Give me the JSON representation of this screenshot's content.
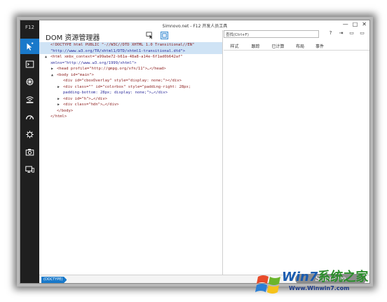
{
  "window": {
    "title": "Simnovo.net - F12 开发人员工具",
    "controls": [
      "—",
      "□",
      "✕"
    ]
  },
  "sidebar": {
    "label": "F12",
    "tools": [
      {
        "name": "dom-explorer",
        "icon": "cursor-icon",
        "active": true
      },
      {
        "name": "console",
        "icon": "console-icon",
        "active": false
      },
      {
        "name": "debugger",
        "icon": "bug-icon",
        "active": false
      },
      {
        "name": "network",
        "icon": "wifi-icon",
        "active": false
      },
      {
        "name": "performance",
        "icon": "gauge-icon",
        "active": false
      },
      {
        "name": "memory",
        "icon": "gear-icon",
        "active": false
      },
      {
        "name": "profiler",
        "icon": "camera-icon",
        "active": false
      },
      {
        "name": "emulation",
        "icon": "monitor-icon",
        "active": false
      }
    ]
  },
  "dom_panel": {
    "title": "DOM 资源管理器",
    "lines": [
      {
        "indent": 0,
        "tri": "",
        "tag": "<!DOCTYPE html PUBLIC \"-//W3C//DTD XHTML 1.0 Transitional//EN\"",
        "selected": true
      },
      {
        "indent": 0,
        "tri": "",
        "tag": "\"http://www.w3.org/TR/xhtml1/DTD/xhtml1-transitional.dtd\">",
        "selected": true
      },
      {
        "indent": 0,
        "tri": "▲",
        "tag": "<html xmbx_context=\"a99abe72-b61a-48a8-a14e-6f1ad0b642af\"",
        "selected": false
      },
      {
        "indent": 0,
        "tri": "",
        "tag": "xmlns=\"http://www.w3.org/1999/xhtml\">",
        "selected": false
      },
      {
        "indent": 1,
        "tri": "▶",
        "tag": "<head profile=\"http://gmpg.org/xfn/11\">…</head>",
        "selected": false
      },
      {
        "indent": 1,
        "tri": "▲",
        "tag": "<body id=\"main\">",
        "selected": false
      },
      {
        "indent": 2,
        "tri": "",
        "tag": "<div id=\"cboxOverlay\" style=\"display: none;\"></div>",
        "selected": false
      },
      {
        "indent": 2,
        "tri": "▶",
        "tag": "<div class=\"\" id=\"colorbox\" style=\"padding-right: 28px;",
        "selected": false
      },
      {
        "indent": 2,
        "tri": "",
        "tag": "padding-bottom: 28px; display: none;\">…</div>",
        "selected": false
      },
      {
        "indent": 2,
        "tri": "▶",
        "tag": "<div id=\"h\">…</div>",
        "selected": false
      },
      {
        "indent": 2,
        "tri": "▶",
        "tag": "<div class=\"hdn\">…</div>",
        "selected": false
      },
      {
        "indent": 1,
        "tri": "",
        "tag": "</body>",
        "selected": false
      },
      {
        "indent": 0,
        "tri": "",
        "tag": "</html>",
        "selected": false
      }
    ]
  },
  "right_panel": {
    "find_placeholder": "查找(Ctrl+F)",
    "icons": [
      "?",
      "⇥",
      "▭",
      "▭"
    ],
    "tabs": [
      "样式",
      "跟踪",
      "已计算",
      "布局",
      "事件"
    ]
  },
  "statusbar": {
    "breadcrumb": "(DOCTYPE)"
  },
  "watermark": {
    "logo": "Simnovo",
    "brand": "Win7系统之家",
    "url": "Www.Winwin7.com"
  },
  "colors": {
    "accent": "#1979ca",
    "sidebar": "#1f1f1f",
    "selection": "#cfe3f5"
  }
}
